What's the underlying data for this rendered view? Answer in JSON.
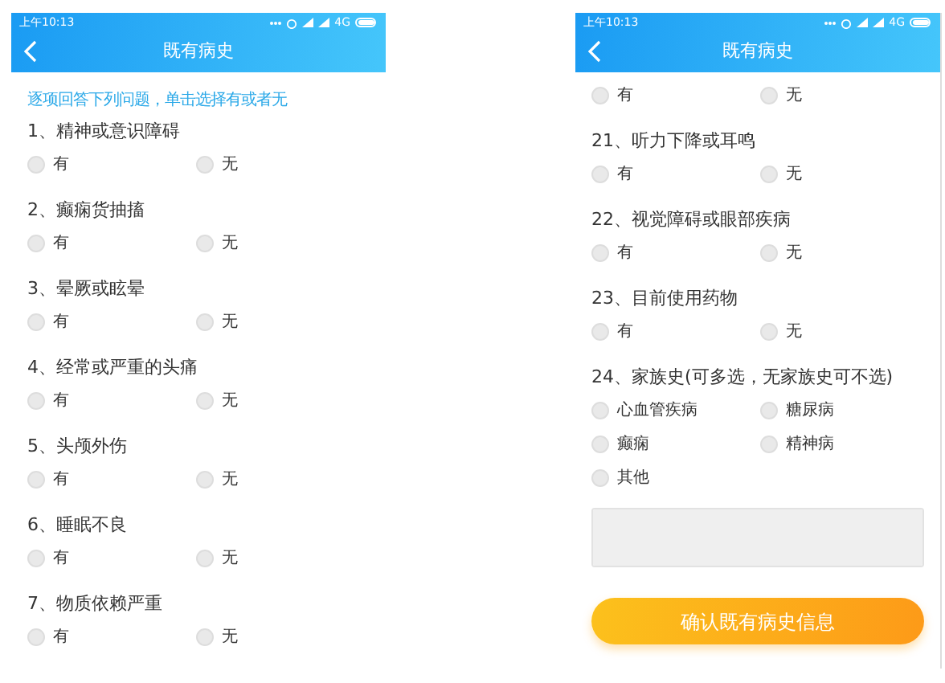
{
  "phones": [
    {
      "status_bar": {
        "time": "上午10:13",
        "network": "4G"
      },
      "header": {
        "title": "既有病史"
      },
      "instruction": "逐项回答下列问题，单击选择有或者无",
      "questions": [
        {
          "title": "1、精神或意识障碍",
          "options": [
            {
              "label": "有",
              "selected": false
            },
            {
              "label": "无",
              "selected": false
            }
          ]
        },
        {
          "title": "2、癫痫货抽搐",
          "options": [
            {
              "label": "有",
              "selected": false
            },
            {
              "label": "无",
              "selected": false
            }
          ]
        },
        {
          "title": "3、晕厥或眩晕",
          "options": [
            {
              "label": "有",
              "selected": false
            },
            {
              "label": "无",
              "selected": false
            }
          ]
        },
        {
          "title": "4、经常或严重的头痛",
          "options": [
            {
              "label": "有",
              "selected": false
            },
            {
              "label": "无",
              "selected": false
            }
          ]
        },
        {
          "title": "5、头颅外伤",
          "options": [
            {
              "label": "有",
              "selected": false
            },
            {
              "label": "无",
              "selected": false
            }
          ]
        },
        {
          "title": "6、睡眠不良",
          "options": [
            {
              "label": "有",
              "selected": false
            },
            {
              "label": "无",
              "selected": false
            }
          ]
        },
        {
          "title": "7、物质依赖严重",
          "options": [
            {
              "label": "有",
              "selected": false
            },
            {
              "label": "无",
              "selected": false
            }
          ]
        }
      ]
    },
    {
      "status_bar": {
        "time": "上午10:13",
        "network": "4G"
      },
      "header": {
        "title": "既有病史"
      },
      "questions": [
        {
          "options": [
            {
              "label": "有",
              "selected": false
            },
            {
              "label": "无",
              "selected": false
            }
          ]
        },
        {
          "title": "21、听力下降或耳鸣",
          "options": [
            {
              "label": "有",
              "selected": false
            },
            {
              "label": "无",
              "selected": false
            }
          ]
        },
        {
          "title": "22、视觉障碍或眼部疾病",
          "options": [
            {
              "label": "有",
              "selected": false
            },
            {
              "label": "无",
              "selected": false
            }
          ]
        },
        {
          "title": "23、目前使用药物",
          "options": [
            {
              "label": "有",
              "selected": false
            },
            {
              "label": "无",
              "selected": false
            }
          ]
        },
        {
          "title": "24、家族史(可多选，无家族史可不选)",
          "options": [
            {
              "label": "心血管疾病",
              "selected": false
            },
            {
              "label": "糖尿病",
              "selected": false
            },
            {
              "label": "癫痫",
              "selected": false
            },
            {
              "label": "精神病",
              "selected": false
            },
            {
              "label": "其他",
              "selected": false
            }
          ]
        }
      ],
      "notes_field": {
        "kind": "textarea"
      },
      "confirm_button": {
        "label": "确认既有病史信息"
      }
    }
  ]
}
